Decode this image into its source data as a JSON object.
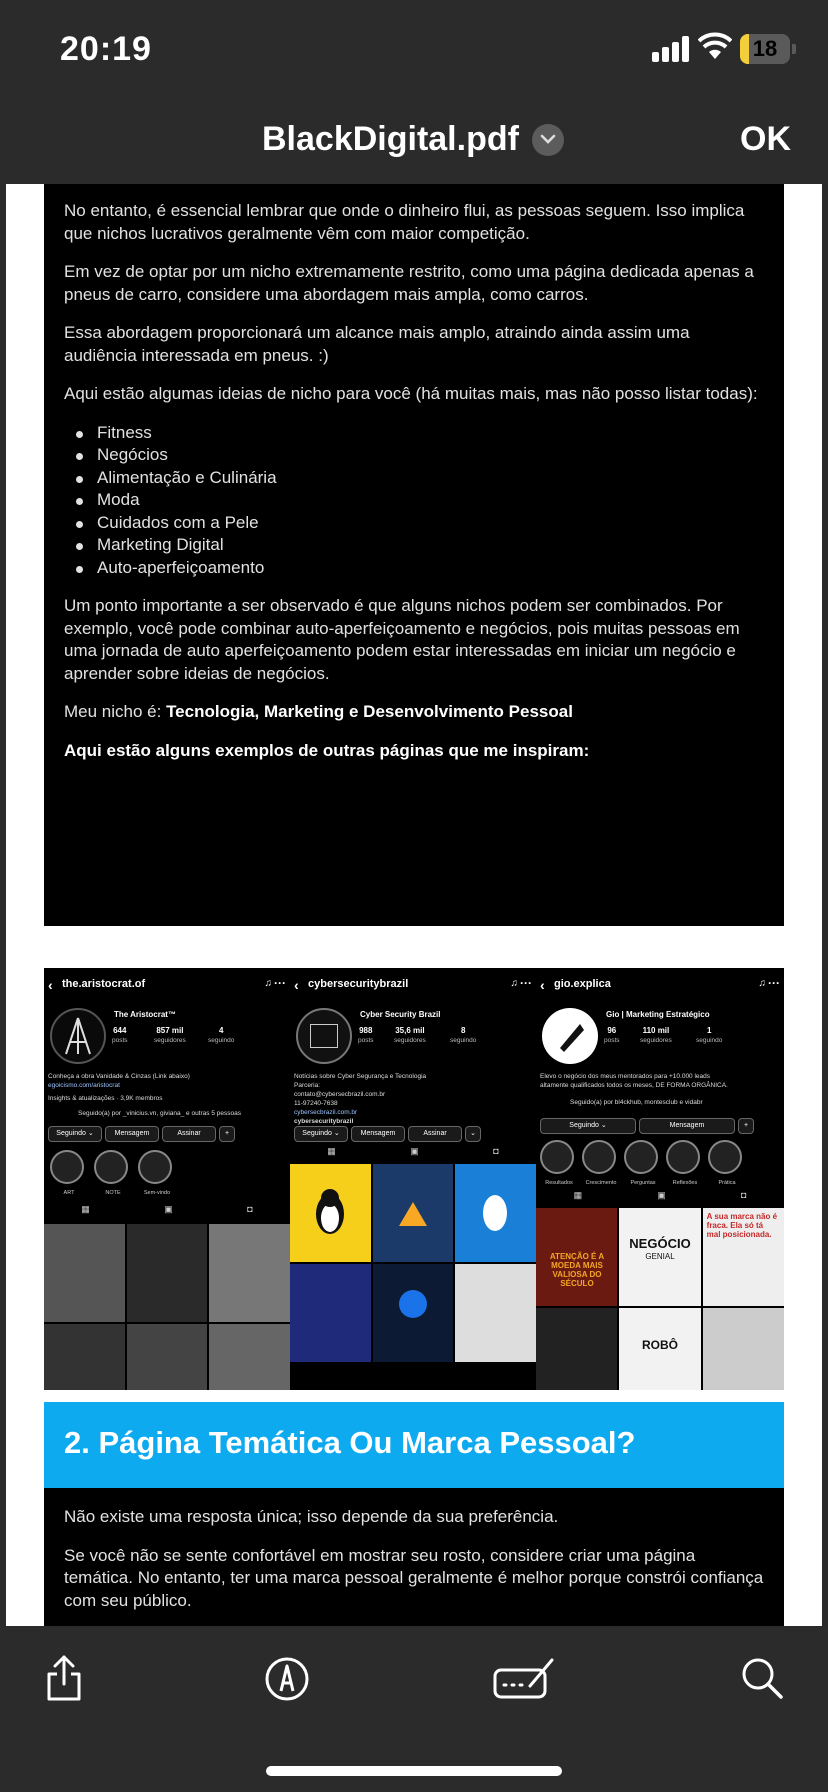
{
  "status_bar": {
    "time": "20:19",
    "battery": "18",
    "battery_level": 0.18
  },
  "nav": {
    "title": "BlackDigital.pdf",
    "ok_label": "OK"
  },
  "page1": {
    "p1": "No entanto, é essencial lembrar que onde o dinheiro flui, as pessoas seguem. Isso implica que nichos lucrativos geralmente vêm com maior competição.",
    "p2": "Em vez de optar por um nicho extremamente restrito, como uma página dedicada apenas a pneus de carro, considere uma abordagem mais ampla, como carros.",
    "p3": "Essa abordagem proporcionará um alcance mais amplo, atraindo ainda assim uma audiência interessada em pneus. :)",
    "p4": "Aqui estão algumas ideias de nicho para você (há muitas mais, mas não posso listar todas):",
    "niches": [
      "Fitness",
      "Negócios",
      "Alimentação e Culinária",
      "Moda",
      "Cuidados com a Pele",
      "Marketing Digital",
      "Auto-aperfeiçoamento"
    ],
    "p5": "Um ponto importante a ser observado é que alguns nichos podem ser combinados. Por exemplo, você pode combinar auto-aperfeiçoamento e negócios, pois muitas pessoas em uma jornada de auto aperfeiçoamento podem estar interessadas em iniciar um negócio e aprender sobre ideias de negócios.",
    "my_niche_prefix": "Meu nicho é: ",
    "my_niche": "Tecnologia, Marketing e Desenvolvimento Pessoal",
    "examples_heading": "Aqui estão alguns exemplos de outras páginas que me inspiram:"
  },
  "profiles": [
    {
      "username": "the.aristocrat.of",
      "name": "The Aristocrat™",
      "stats": [
        {
          "n": "644",
          "l": "posts"
        },
        {
          "n": "857 mil",
          "l": "seguidores"
        },
        {
          "n": "4",
          "l": "seguindo"
        }
      ],
      "bio": [
        "Conheça a obra Vanidade & Cinzas (Link abaixo)"
      ],
      "link": "egoicismo.com/aristocrat",
      "extra": "Insights & atualizações · 3,9K membros",
      "followed": "Seguido(a) por _vinicius.vn, giviana_ e outras 5 pessoas",
      "buttons": [
        "Seguindo ⌄",
        "Mensagem",
        "Assinar",
        "+ "
      ],
      "highlights": [
        "ART",
        "NOTE",
        "Sem-vindo"
      ]
    },
    {
      "username": "cybersecuritybrazil",
      "name": "Cyber Security Brazil",
      "stats": [
        {
          "n": "988",
          "l": "posts"
        },
        {
          "n": "35,6 mil",
          "l": "seguidores"
        },
        {
          "n": "8",
          "l": "seguindo"
        }
      ],
      "bio": [
        "Notícias sobre Cyber Segurança e Tecnologia",
        "Parceria:",
        "contato@cybersecbrazil.com.br",
        "11-97240-7638"
      ],
      "link": "cybersecbrazil.com.br",
      "extra": "cybersecuritybrazil",
      "buttons": [
        "Seguindo ⌄",
        "Mensagem",
        "Assinar",
        "⌄"
      ]
    },
    {
      "username": "gio.explica",
      "name": "Gio | Marketing Estratégico",
      "stats": [
        {
          "n": "96",
          "l": "posts"
        },
        {
          "n": "110 mil",
          "l": "seguidores"
        },
        {
          "n": "1",
          "l": "seguindo"
        }
      ],
      "bio": [
        "Elevo o negócio dos meus mentorados para +10.000 leads altamente qualificados todos os meses, DE FORMA ORGÂNICA."
      ],
      "followed": "Seguido(a) por bl4ckhub, montesclub e vidabr",
      "buttons": [
        "Seguindo ⌄",
        "Mensagem",
        "+ "
      ],
      "highlights": [
        "Resultados",
        "Crescimento",
        "Perguntas",
        "Reflexões",
        "Prática"
      ],
      "tiles": [
        "ATENÇÃO É A MOEDA MAIS VALIOSA DO SÉCULO",
        "NEGÓCIO",
        "GENIAL",
        "A sua marca não é fraca. Ela só tá mal posicionada.",
        "ROBÔ"
      ]
    }
  ],
  "page2": {
    "heading": "2. Página Temática Ou Marca Pessoal?",
    "p1": "Não existe uma resposta única; isso depende da sua preferência.",
    "p2": "Se você não se sente confortável em mostrar seu rosto, considere criar uma página temática. No entanto, ter uma marca pessoal geralmente é melhor porque constrói confiança com seu público."
  },
  "toolbar": {
    "icons": [
      "share-icon",
      "markup-icon",
      "signature-icon",
      "search-icon"
    ]
  },
  "colors": {
    "heading_bar": "#0EAAF0",
    "battery": "#F5CF3B"
  }
}
